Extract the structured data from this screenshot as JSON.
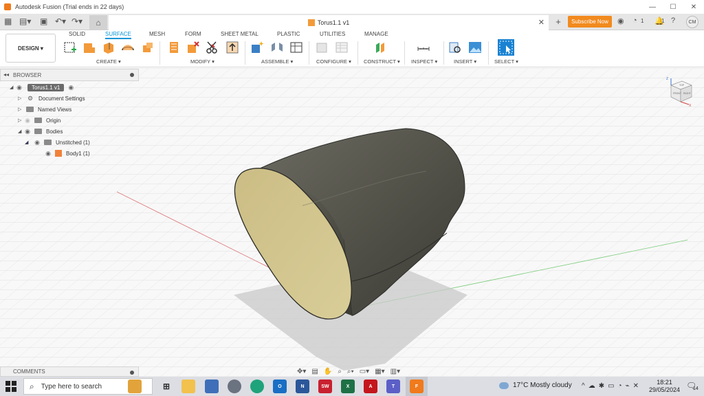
{
  "window": {
    "title": "Autodesk Fusion (Trial ends in 22 days)",
    "controls": [
      "—",
      "☐",
      "✕"
    ]
  },
  "tabs": {
    "document_tab": "Torus1.1 v1",
    "close": "✕",
    "plus": "+",
    "subscribe": "Subscribe Now",
    "job_count": "1",
    "notif_count": "1",
    "avatar": "CM"
  },
  "toolbar": {
    "design_button": "DESIGN ▾",
    "workspace_tabs": [
      "SOLID",
      "SURFACE",
      "MESH",
      "FORM",
      "SHEET METAL",
      "PLASTIC",
      "UTILITIES",
      "MANAGE"
    ],
    "active_tab": "SURFACE",
    "groups": [
      "CREATE ▾",
      "MODIFY ▾",
      "ASSEMBLE ▾",
      "CONFIGURE ▾",
      "CONSTRUCT ▾",
      "INSPECT ▾",
      "INSERT ▾",
      "SELECT ▾"
    ]
  },
  "browser": {
    "title": "BROWSER",
    "items": [
      {
        "label": "Torus1.1 v1"
      },
      {
        "label": "Document Settings"
      },
      {
        "label": "Named Views"
      },
      {
        "label": "Origin"
      },
      {
        "label": "Bodies"
      },
      {
        "label": "Unstitched (1)"
      },
      {
        "label": "Body1 (1)"
      }
    ]
  },
  "comments": {
    "title": "COMMENTS"
  },
  "viewcube": {
    "label_top": "TOP",
    "label_front": "FRONT",
    "label_right": "RIGHT",
    "axis_z": "Z",
    "axis_x": "X"
  },
  "taskbar": {
    "search_placeholder": "Type here to search",
    "weather": "17°C  Mostly cloudy",
    "time": "18:21",
    "date": "29/05/2024",
    "notif_badge": "14"
  },
  "colors": {
    "accent": "#0696d7",
    "subscribe": "#f28a1e",
    "body_surface": "#5a5a52",
    "inner_face": "#c9b87a"
  }
}
